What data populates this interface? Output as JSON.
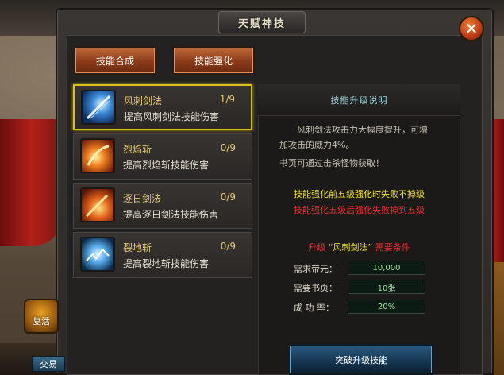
{
  "window": {
    "title": "天赋神技",
    "close_symbol": "✕"
  },
  "tabs": [
    {
      "label": "技能合成"
    },
    {
      "label": "技能强化"
    }
  ],
  "skills": [
    {
      "name": "风刺剑法",
      "level": "1/9",
      "desc": "提高风刺剑法技能伤害",
      "icon": "wind-sword-icon",
      "selected": true
    },
    {
      "name": "烈焰斩",
      "level": "0/9",
      "desc": "提高烈焰斩技能伤害",
      "icon": "flame-slash-icon",
      "selected": false
    },
    {
      "name": "逐日剑法",
      "level": "0/9",
      "desc": "提高逐日剑法技能伤害",
      "icon": "sun-chase-sword-icon",
      "selected": false
    },
    {
      "name": "裂地斩",
      "level": "0/9",
      "desc": "提高裂地斩技能伤害",
      "icon": "earth-split-icon",
      "selected": false
    }
  ],
  "info": {
    "title": "技能升级说明",
    "desc_line1": "风刺剑法攻击力大幅度提升，可增",
    "desc_line2": "加攻击的威力4%。",
    "note": "书页可通过击杀怪物获取！",
    "warning_yellow": "技能强化前五级强化时失败不掉级",
    "warning_red": "技能强化五级后强化失败掉到五级",
    "req_prefix": "升级",
    "req_skill": "“风刺剑法”",
    "req_suffix": "需要条件",
    "requirements": [
      {
        "label": "需求帝元：",
        "value": "10,000"
      },
      {
        "label": "需要书页：",
        "value": "10张"
      },
      {
        "label": "成 功 率：",
        "value": "20%"
      }
    ],
    "upgrade_button": "突破升级技能"
  },
  "hud": {
    "revive_label": "复活",
    "trade_label": "交易"
  },
  "colors": {
    "accent_gold": "#e8c878",
    "warning_yellow": "#f0e030",
    "warning_red": "#e83030",
    "selected_border": "#d8c020",
    "info_title": "#9ad8e0"
  }
}
